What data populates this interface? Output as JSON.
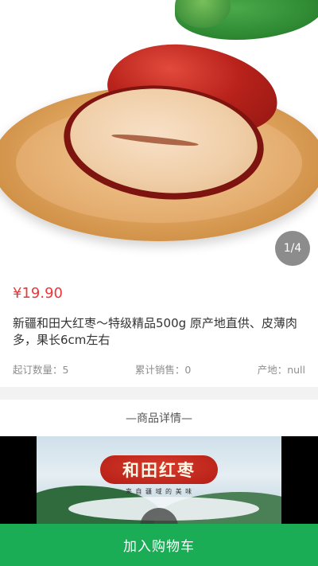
{
  "gallery": {
    "counter": "1/4",
    "image_description_icon": "jujube-photo"
  },
  "product": {
    "price": "¥19.90",
    "title": "新疆和田大红枣～特级精品500g 原产地直供、皮薄肉多，果长6cm左右",
    "min_order": "起订数量：5",
    "total_sales": "累计销售：0",
    "origin": "产地：null"
  },
  "details": {
    "heading": "—商品详情—",
    "banner_title": "和田红枣",
    "banner_subtitle": "来 自 疆 域 的 美 味"
  },
  "footer": {
    "add_to_cart": "加入购物车"
  },
  "colors": {
    "price": "#e8383a",
    "cart_button": "#1aad56"
  }
}
